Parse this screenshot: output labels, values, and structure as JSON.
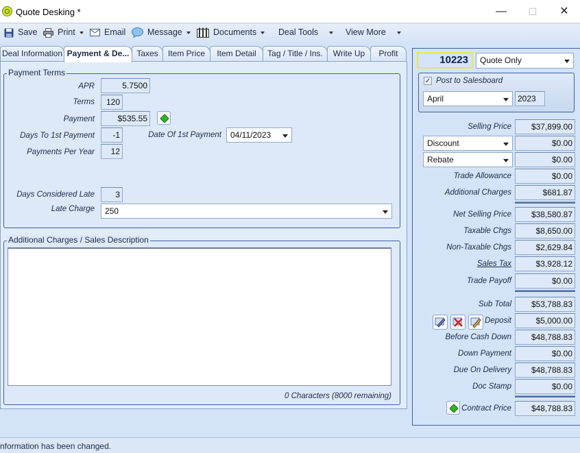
{
  "window": {
    "title": "Quote Desking *",
    "minimize": "—",
    "maximize": "☐",
    "close": "✕"
  },
  "toolbar": {
    "save": "Save",
    "print": "Print",
    "email": "Email",
    "message": "Message",
    "documents": "Documents",
    "deal_tools": "Deal Tools",
    "view_more": "View More"
  },
  "tabs": [
    {
      "label": "Deal Information"
    },
    {
      "label": "Payment & De..."
    },
    {
      "label": "Taxes"
    },
    {
      "label": "Item Price"
    },
    {
      "label": "Item Detail"
    },
    {
      "label": "Tag / Title / Ins."
    },
    {
      "label": "Write Up"
    },
    {
      "label": "Profit"
    }
  ],
  "payment_terms": {
    "title": "Payment Terms",
    "apr_label": "APR",
    "apr": "5.7500",
    "terms_label": "Terms",
    "terms": "120",
    "payment_label": "Payment",
    "payment": "$535.55",
    "days_first_label": "Days To 1st Payment",
    "days_first": "-1",
    "date_first_label": "Date Of 1st Payment",
    "date_first": "04/11/2023",
    "ppy_label": "Payments Per Year",
    "ppy": "12",
    "days_late_label": "Days Considered Late",
    "days_late": "3",
    "late_charge_label": "Late Charge",
    "late_charge": "250"
  },
  "additional": {
    "title": "Additional Charges / Sales Description",
    "text": "",
    "char_count": "0 Characters (8000 remaining)"
  },
  "right": {
    "deal_number": "10223",
    "quote_type": "Quote Only",
    "post_label": "Post to Salesboard",
    "post_checked": true,
    "month": "April",
    "year": "2023",
    "selling_price_label": "Selling Price",
    "selling_price": "$37,899.00",
    "discount_label": "Discount",
    "discount": "$0.00",
    "rebate_label": "Rebate",
    "rebate": "$0.00",
    "trade_allowance_label": "Trade Allowance",
    "trade_allowance": "$0.00",
    "additional_charges_label": "Additional Charges",
    "additional_charges": "$681.87",
    "net_selling_label": "Net Selling Price",
    "net_selling": "$38,580.87",
    "taxable_label": "Taxable Chgs",
    "taxable": "$8,650.00",
    "nontaxable_label": "Non-Taxable Chgs",
    "nontaxable": "$2,629.84",
    "sales_tax_label": "Sales Tax",
    "sales_tax": "$3,928.12",
    "trade_payoff_label": "Trade Payoff",
    "trade_payoff": "$0.00",
    "subtotal_label": "Sub Total",
    "subtotal": "$53,788.83",
    "deposit_label": "Deposit",
    "deposit": "$5,000.00",
    "before_cash_label": "Before Cash Down",
    "before_cash": "$48,788.83",
    "down_payment_label": "Down Payment",
    "down_payment": "$0.00",
    "due_delivery_label": "Due On Delivery",
    "due_delivery": "$48,788.83",
    "doc_stamp_label": "Doc Stamp",
    "doc_stamp": "$0.00",
    "contract_price_label": "Contract Price",
    "contract_price": "$48,788.83"
  },
  "status": {
    "text": "nformation has been changed."
  },
  "colors": {
    "accent": "#3f5fa0",
    "panel": "#d4e3f7",
    "deal_number_border": "#e8e84a",
    "green": "#2fb31d",
    "red": "#d81e1e"
  }
}
